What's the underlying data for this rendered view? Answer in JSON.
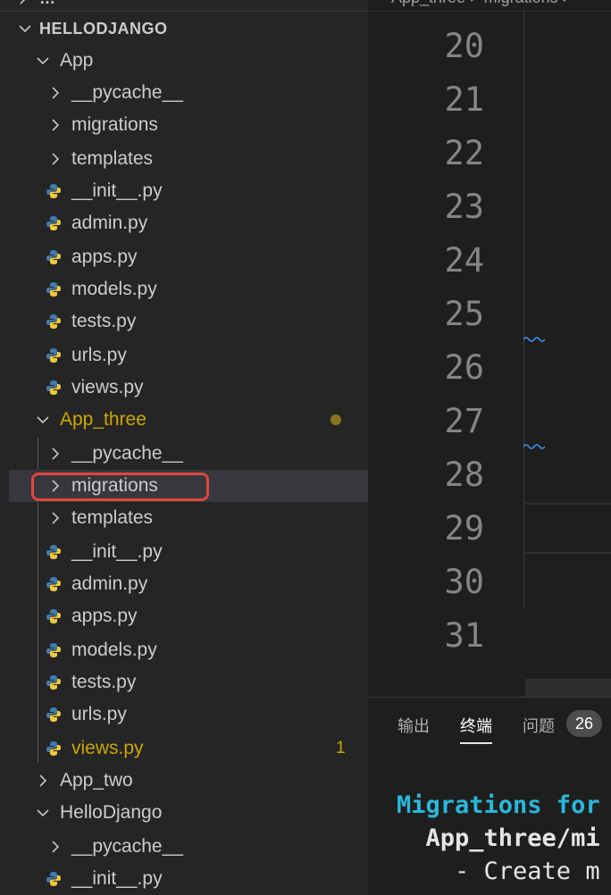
{
  "colors": {
    "accent": "#e0463b",
    "modified": "#cca700",
    "term_cyan": "#29b8db",
    "python_blue": "#3e7cb1",
    "python_yellow": "#f0c93a"
  },
  "explorer": {
    "top_cut_label": "…",
    "root": "HELLODJANGO",
    "app": {
      "name": "App",
      "children": [
        "__pycache__",
        "migrations",
        "templates",
        "__init__.py",
        "admin.py",
        "apps.py",
        "models.py",
        "tests.py",
        "urls.py",
        "views.py"
      ]
    },
    "app_three": {
      "name": "App_three",
      "children": [
        "__pycache__",
        "migrations",
        "templates",
        "__init__.py",
        "admin.py",
        "apps.py",
        "models.py",
        "tests.py",
        "urls.py",
        "views.py"
      ],
      "views_problem_count": "1"
    },
    "app_two": {
      "name": "App_two"
    },
    "hellodjango": {
      "name": "HelloDjango",
      "children": [
        "__pycache__",
        "__init__.py"
      ]
    }
  },
  "editor": {
    "breadcrumb": "App_three  >  migrations  >",
    "line_numbers": [
      "20",
      "21",
      "22",
      "23",
      "24",
      "25",
      "26",
      "27",
      "28",
      "29",
      "30",
      "31"
    ]
  },
  "panel": {
    "tabs": [
      "输出",
      "终端",
      "问题"
    ],
    "active_tab": "终端",
    "problems_count": "26",
    "terminal_lines": [
      "Migrations for",
      "  App_three/mi",
      "    - Create m"
    ]
  }
}
